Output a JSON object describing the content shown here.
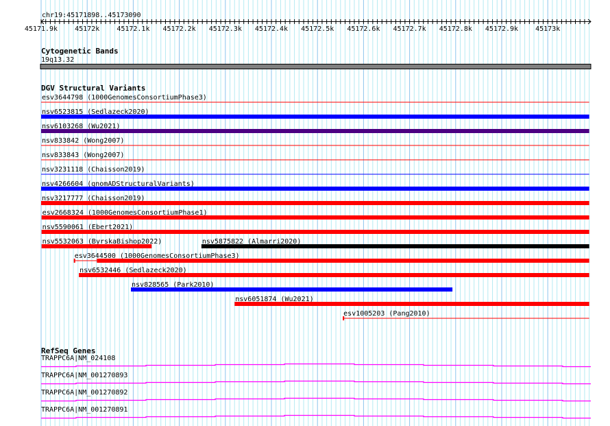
{
  "view": {
    "location": "chr19:45171898..45173090",
    "start": 45171898,
    "end": 45173090
  },
  "ruler": {
    "labels": [
      "45171.9k",
      "45172k",
      "45172.1k",
      "45172.2k",
      "45172.3k",
      "45172.4k",
      "45172.5k",
      "45172.6k",
      "45172.7k",
      "45172.8k",
      "45172.9k",
      "45173k"
    ],
    "label_positions_bp": [
      45171900,
      45172000,
      45172100,
      45172200,
      45172300,
      45172400,
      45172500,
      45172600,
      45172700,
      45172800,
      45172900,
      45173000
    ]
  },
  "tracks": {
    "cytoband": {
      "title": "Cytogenetic Bands",
      "band_label": "19q13.32",
      "color": "#808080"
    },
    "dgv": {
      "title": "DGV Structural Variants",
      "features": [
        {
          "label": "esv3644798 (1000GenomesConsortiumPhase3)",
          "row": 0,
          "start": 45171898,
          "end": 45173090,
          "color": "#ff0000",
          "style": "thin"
        },
        {
          "label": "nsv6523815 (Sedlazeck2020)",
          "row": 1,
          "start": 45171898,
          "end": 45173090,
          "color": "#0000ff",
          "style": "thick"
        },
        {
          "label": "nsv6103268 (Wu2021)",
          "row": 2,
          "start": 45171898,
          "end": 45173090,
          "color": "#4b0082",
          "style": "thick"
        },
        {
          "label": "nsv833842 (Wong2007)",
          "row": 3,
          "start": 45171898,
          "end": 45173090,
          "color": "#ff0000",
          "style": "thin"
        },
        {
          "label": "nsv833843 (Wong2007)",
          "row": 4,
          "start": 45171898,
          "end": 45173090,
          "color": "#ff0000",
          "style": "thin"
        },
        {
          "label": "nsv3231118 (Chaisson2019)",
          "row": 5,
          "start": 45171898,
          "end": 45173090,
          "color": "#0000ff",
          "style": "thin"
        },
        {
          "label": "nsv4266604 (gnomADStructuralVariants)",
          "row": 6,
          "start": 45171898,
          "end": 45173090,
          "color": "#0000ff",
          "style": "thick"
        },
        {
          "label": "nsv3217777 (Chaisson2019)",
          "row": 7,
          "start": 45171898,
          "end": 45173090,
          "color": "#ff0000",
          "style": "thick"
        },
        {
          "label": "esv2668324 (1000GenomesConsortiumPhase1)",
          "row": 8,
          "start": 45171901,
          "end": 45173090,
          "color": "#ff0000",
          "style": "thick"
        },
        {
          "label": "nsv5590061 (Ebert2021)",
          "row": 9,
          "start": 45171901,
          "end": 45173090,
          "color": "#ff0000",
          "style": "thick"
        },
        {
          "label": "nsv5532063 (ByrskaBishop2022)",
          "row": 10,
          "start": 45171901,
          "end": 45172140,
          "color": "#ff0000",
          "style": "thick"
        },
        {
          "label": "nsv5875822 (Almarri2020)",
          "row": 10,
          "start": 45172248,
          "end": 45173090,
          "color": "#000000",
          "style": "thick"
        },
        {
          "label": "esv3644500 (1000GenomesConsortiumPhase3)",
          "row": 11,
          "start": 45171971,
          "end": 45173090,
          "thick_start": 45172021,
          "color": "#ff0000",
          "style": "mixed"
        },
        {
          "label": "nsv6532446 (Sedlazeck2020)",
          "row": 12,
          "start": 45171982,
          "end": 45173090,
          "color": "#ff0000",
          "style": "thick"
        },
        {
          "label": "nsv828565 (Park2010)",
          "row": 13,
          "start": 45172095,
          "end": 45172793,
          "color": "#0000ff",
          "style": "thick"
        },
        {
          "label": "nsv6051874 (Wu2021)",
          "row": 14,
          "start": 45172320,
          "end": 45173090,
          "color": "#ff0000",
          "style": "thick"
        },
        {
          "label": "esv1005203 (Pang2010)",
          "row": 15,
          "start": 45172555,
          "end": 45173090,
          "color": "#ff0000",
          "style": "tick-thin"
        }
      ]
    },
    "refseq": {
      "title": "RefSeq Genes",
      "color": "#ff00ff",
      "genes": [
        {
          "label": "TRAPPC6A|NM_024108"
        },
        {
          "label": "TRAPPC6A|NM_001270893"
        },
        {
          "label": "TRAPPC6A|NM_001270892"
        },
        {
          "label": "TRAPPC6A|NM_001270891"
        }
      ]
    }
  }
}
